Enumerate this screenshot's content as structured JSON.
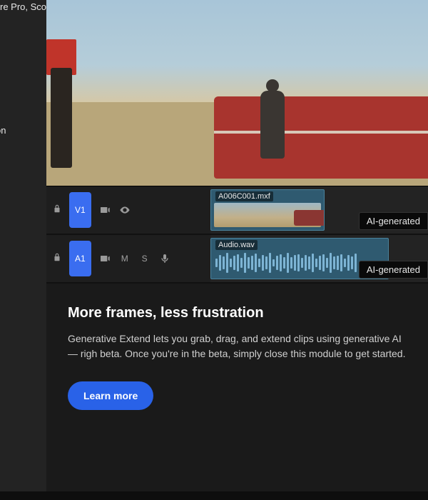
{
  "header": {
    "app_title": "re Pro, Scott"
  },
  "sidebar": {
    "item_label": "on"
  },
  "timeline": {
    "video_track": {
      "id": "V1",
      "clip_name": "A006C001.mxf",
      "ai_label": "AI-generated"
    },
    "audio_track": {
      "id": "A1",
      "mute": "M",
      "solo": "S",
      "clip_name": "Audio.wav",
      "ai_label": "AI-generated"
    }
  },
  "promo": {
    "heading": "More frames, less frustration",
    "body": "Generative Extend lets you grab, drag, and extend clips using generative AI — righ beta. Once you're in the beta, simply close this module to get started.",
    "cta": "Learn more"
  },
  "footer": {
    "hint": ""
  },
  "colors": {
    "accent": "#3a6df0",
    "cta": "#2962e8"
  }
}
